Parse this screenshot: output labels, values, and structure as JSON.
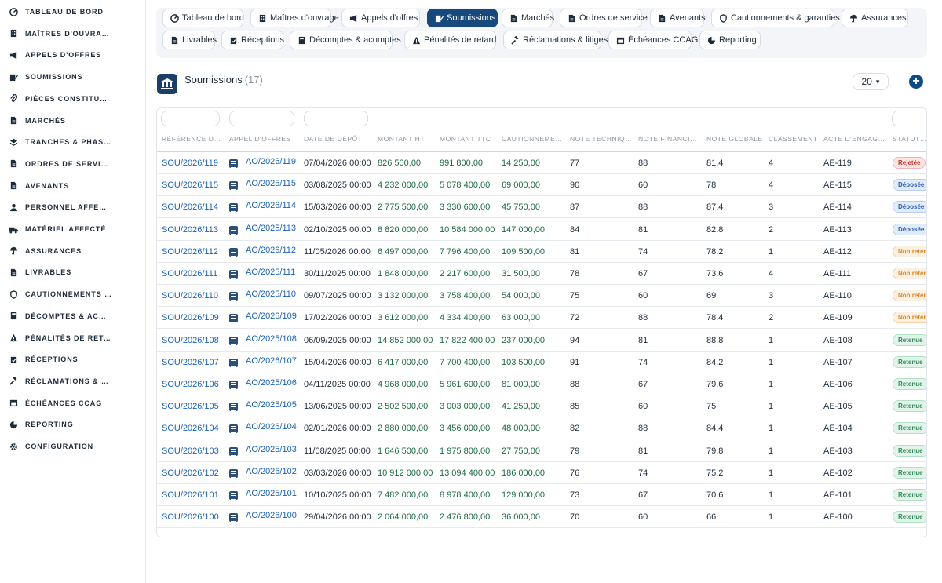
{
  "sidebar": {
    "items": [
      {
        "label": "Tableau de bord",
        "icon": "dashboard-icon"
      },
      {
        "label": "Maîtres d'ouvrage",
        "icon": "building-icon"
      },
      {
        "label": "Appels d'offres",
        "icon": "megaphone-icon"
      },
      {
        "label": "Soumissions",
        "icon": "edit-document-icon"
      },
      {
        "label": "Pièces constitutives",
        "icon": "paperclip-icon"
      },
      {
        "label": "Marchés",
        "icon": "document-icon"
      },
      {
        "label": "Tranches & phases",
        "icon": "layers-icon"
      },
      {
        "label": "Ordres de service",
        "icon": "document-icon"
      },
      {
        "label": "Avenants",
        "icon": "document-icon"
      },
      {
        "label": "Personnel affecté",
        "icon": "person-icon"
      },
      {
        "label": "Matériel affecté",
        "icon": "truck-icon"
      },
      {
        "label": "Assurances",
        "icon": "umbrella-icon"
      },
      {
        "label": "Livrables",
        "icon": "document-icon"
      },
      {
        "label": "Cautionnements & garanties",
        "icon": "shield-icon"
      },
      {
        "label": "Décomptes & acomptes",
        "icon": "calculator-icon"
      },
      {
        "label": "Pénalités de retard",
        "icon": "warning-icon"
      },
      {
        "label": "Réceptions",
        "icon": "clipboard-check-icon"
      },
      {
        "label": "Réclamations & litiges",
        "icon": "gavel-icon"
      },
      {
        "label": "Échéances CCAG",
        "icon": "calendar-icon"
      },
      {
        "label": "Reporting",
        "icon": "pie-chart-icon"
      },
      {
        "label": "Configuration",
        "icon": "gear-icon"
      }
    ]
  },
  "topmenu": [
    {
      "label": "Tableau de bord",
      "icon": "dashboard-icon"
    },
    {
      "label": "Maîtres d'ouvrage",
      "icon": "building-icon"
    },
    {
      "label": "Appels d'offres",
      "icon": "megaphone-icon"
    },
    {
      "label": "Soumissions",
      "icon": "edit-document-icon",
      "active": true
    },
    {
      "label": "Marchés",
      "icon": "document-icon"
    },
    {
      "label": "Ordres de service",
      "icon": "document-icon"
    },
    {
      "label": "Avenants",
      "icon": "document-icon"
    },
    {
      "label": "Cautionnements & garanties",
      "icon": "shield-icon"
    },
    {
      "label": "Assurances",
      "icon": "umbrella-icon"
    },
    {
      "label": "Livrables",
      "icon": "document-icon"
    },
    {
      "label": "Réceptions",
      "icon": "clipboard-check-icon"
    },
    {
      "label": "Décomptes & acomptes",
      "icon": "calculator-icon"
    },
    {
      "label": "Pénalités de retard",
      "icon": "warning-icon"
    },
    {
      "label": "Réclamations & litiges",
      "icon": "gavel-icon"
    },
    {
      "label": "Échéances CCAG",
      "icon": "calendar-icon"
    },
    {
      "label": "Reporting",
      "icon": "pie-chart-icon"
    }
  ],
  "page": {
    "title": "Soumissions",
    "count": "(17)",
    "per_page": "20",
    "add_icon": "plus-circle-icon"
  },
  "table": {
    "columns": [
      "Référence de soumission",
      "Appel d'offres",
      "Date de dépôt",
      "Montant HT",
      "Montant TTC",
      "Cautionnement",
      "Note technique",
      "Note financière",
      "Note globale",
      "Classement",
      "Acte d'engagement",
      "Statut de la soumission"
    ],
    "status_colors": {
      "Rejetée": {
        "bg": "#fde3e3",
        "fg": "#c0392b",
        "border": "#f3b4b4"
      },
      "Déposée": {
        "bg": "#e1ecfb",
        "fg": "#2c5fae",
        "border": "#b9cff0"
      },
      "Non retenue": {
        "bg": "#fdf0e1",
        "fg": "#d98a2b",
        "border": "#f4d2a6"
      },
      "Retenue": {
        "bg": "#e2f4ea",
        "fg": "#2e8b57",
        "border": "#b4dfc6"
      }
    },
    "rows": [
      {
        "ref": "SOU/2026/119",
        "ao": "AO/2026/119",
        "date": "07/04/2026 00:00",
        "ht": "826 500,00",
        "ttc": "991 800,00",
        "caution": "14 250,00",
        "tech": "77",
        "fin": "88",
        "glob": "81.4",
        "rank": "4",
        "acte": "AE-119",
        "status": "Rejetée"
      },
      {
        "ref": "SOU/2026/115",
        "ao": "AO/2025/115",
        "date": "03/08/2025 00:00",
        "ht": "4 232 000,00",
        "ttc": "5 078 400,00",
        "caution": "69 000,00",
        "tech": "90",
        "fin": "60",
        "glob": "78",
        "rank": "4",
        "acte": "AE-115",
        "status": "Déposée"
      },
      {
        "ref": "SOU/2026/114",
        "ao": "AO/2026/114",
        "date": "15/03/2026 00:00",
        "ht": "2 775 500,00",
        "ttc": "3 330 600,00",
        "caution": "45 750,00",
        "tech": "87",
        "fin": "88",
        "glob": "87.4",
        "rank": "3",
        "acte": "AE-114",
        "status": "Déposée"
      },
      {
        "ref": "SOU/2026/113",
        "ao": "AO/2025/113",
        "date": "02/10/2025 00:00",
        "ht": "8 820 000,00",
        "ttc": "10 584 000,00",
        "caution": "147 000,00",
        "tech": "84",
        "fin": "81",
        "glob": "82.8",
        "rank": "2",
        "acte": "AE-113",
        "status": "Déposée"
      },
      {
        "ref": "SOU/2026/112",
        "ao": "AO/2026/112",
        "date": "11/05/2026 00:00",
        "ht": "6 497 000,00",
        "ttc": "7 796 400,00",
        "caution": "109 500,00",
        "tech": "81",
        "fin": "74",
        "glob": "78.2",
        "rank": "1",
        "acte": "AE-112",
        "status": "Non retenue"
      },
      {
        "ref": "SOU/2026/111",
        "ao": "AO/2025/111",
        "date": "30/11/2025 00:00",
        "ht": "1 848 000,00",
        "ttc": "2 217 600,00",
        "caution": "31 500,00",
        "tech": "78",
        "fin": "67",
        "glob": "73.6",
        "rank": "4",
        "acte": "AE-111",
        "status": "Non retenue"
      },
      {
        "ref": "SOU/2026/110",
        "ao": "AO/2025/110",
        "date": "09/07/2025 00:00",
        "ht": "3 132 000,00",
        "ttc": "3 758 400,00",
        "caution": "54 000,00",
        "tech": "75",
        "fin": "60",
        "glob": "69",
        "rank": "3",
        "acte": "AE-110",
        "status": "Non retenue"
      },
      {
        "ref": "SOU/2026/109",
        "ao": "AO/2026/109",
        "date": "17/02/2026 00:00",
        "ht": "3 612 000,00",
        "ttc": "4 334 400,00",
        "caution": "63 000,00",
        "tech": "72",
        "fin": "88",
        "glob": "78.4",
        "rank": "2",
        "acte": "AE-109",
        "status": "Non retenue"
      },
      {
        "ref": "SOU/2026/108",
        "ao": "AO/2025/108",
        "date": "06/09/2025 00:00",
        "ht": "14 852 000,00",
        "ttc": "17 822 400,00",
        "caution": "237 000,00",
        "tech": "94",
        "fin": "81",
        "glob": "88.8",
        "rank": "1",
        "acte": "AE-108",
        "status": "Retenue"
      },
      {
        "ref": "SOU/2026/107",
        "ao": "AO/2026/107",
        "date": "15/04/2026 00:00",
        "ht": "6 417 000,00",
        "ttc": "7 700 400,00",
        "caution": "103 500,00",
        "tech": "91",
        "fin": "74",
        "glob": "84.2",
        "rank": "1",
        "acte": "AE-107",
        "status": "Retenue"
      },
      {
        "ref": "SOU/2026/106",
        "ao": "AO/2025/106",
        "date": "04/11/2025 00:00",
        "ht": "4 968 000,00",
        "ttc": "5 961 600,00",
        "caution": "81 000,00",
        "tech": "88",
        "fin": "67",
        "glob": "79.6",
        "rank": "1",
        "acte": "AE-106",
        "status": "Retenue"
      },
      {
        "ref": "SOU/2026/105",
        "ao": "AO/2025/105",
        "date": "13/06/2025 00:00",
        "ht": "2 502 500,00",
        "ttc": "3 003 000,00",
        "caution": "41 250,00",
        "tech": "85",
        "fin": "60",
        "glob": "75",
        "rank": "1",
        "acte": "AE-105",
        "status": "Retenue"
      },
      {
        "ref": "SOU/2026/104",
        "ao": "AO/2026/104",
        "date": "02/01/2026 00:00",
        "ht": "2 880 000,00",
        "ttc": "3 456 000,00",
        "caution": "48 000,00",
        "tech": "82",
        "fin": "88",
        "glob": "84.4",
        "rank": "1",
        "acte": "AE-104",
        "status": "Retenue"
      },
      {
        "ref": "SOU/2026/103",
        "ao": "AO/2025/103",
        "date": "11/08/2025 00:00",
        "ht": "1 646 500,00",
        "ttc": "1 975 800,00",
        "caution": "27 750,00",
        "tech": "79",
        "fin": "81",
        "glob": "79.8",
        "rank": "1",
        "acte": "AE-103",
        "status": "Retenue"
      },
      {
        "ref": "SOU/2026/102",
        "ao": "AO/2026/102",
        "date": "03/03/2026 00:00",
        "ht": "10 912 000,00",
        "ttc": "13 094 400,00",
        "caution": "186 000,00",
        "tech": "76",
        "fin": "74",
        "glob": "75.2",
        "rank": "1",
        "acte": "AE-102",
        "status": "Retenue"
      },
      {
        "ref": "SOU/2026/101",
        "ao": "AO/2025/101",
        "date": "10/10/2025 00:00",
        "ht": "7 482 000,00",
        "ttc": "8 978 400,00",
        "caution": "129 000,00",
        "tech": "73",
        "fin": "67",
        "glob": "70.6",
        "rank": "1",
        "acte": "AE-101",
        "status": "Retenue"
      },
      {
        "ref": "SOU/2026/100",
        "ao": "AO/2026/100",
        "date": "29/04/2026 00:00",
        "ht": "2 064 000,00",
        "ttc": "2 476 800,00",
        "caution": "36 000,00",
        "tech": "70",
        "fin": "60",
        "glob": "66",
        "rank": "1",
        "acte": "AE-100",
        "status": "Retenue"
      }
    ]
  }
}
